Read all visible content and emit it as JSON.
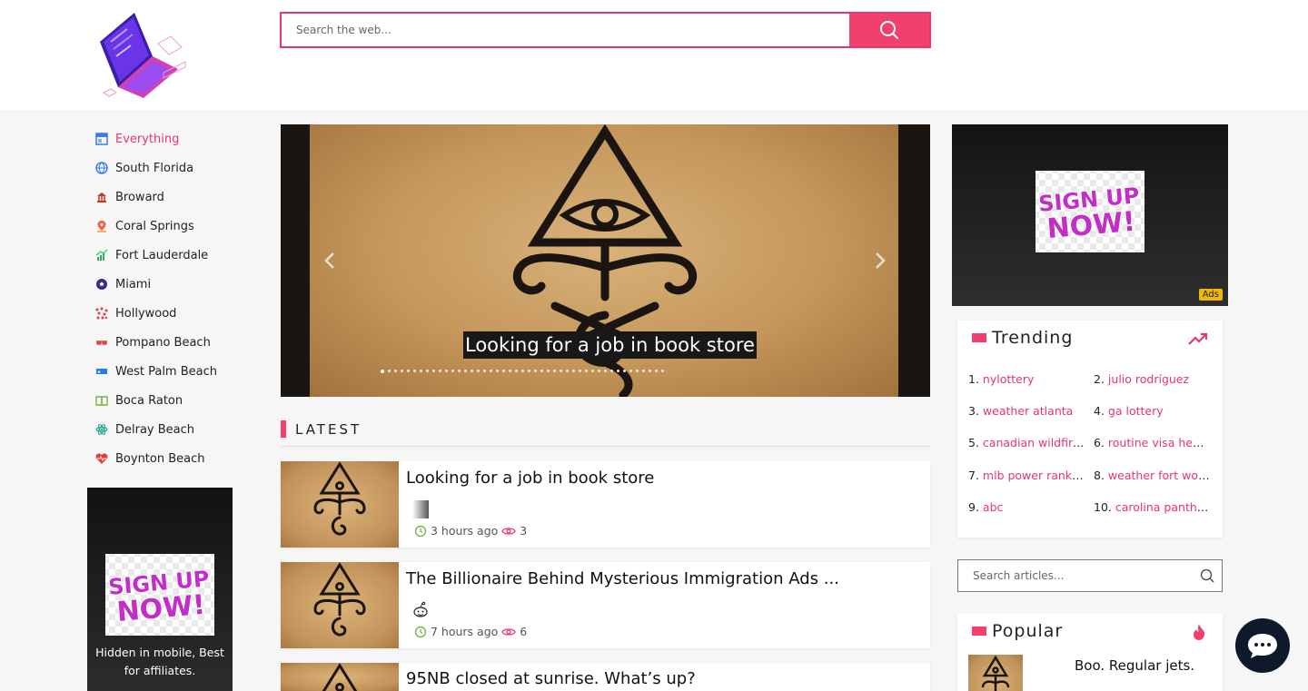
{
  "header": {
    "search_placeholder": "Search the web...",
    "search_button_icon": "search-icon",
    "accent_color": "#f2406e"
  },
  "sidebar": {
    "items": [
      {
        "label": "Everything",
        "icon": "layout-icon",
        "active": true
      },
      {
        "label": "South Florida",
        "icon": "globe-icon"
      },
      {
        "label": "Broward",
        "icon": "capitol-icon"
      },
      {
        "label": "Coral Springs",
        "icon": "map-pin-icon"
      },
      {
        "label": "Fort Lauderdale",
        "icon": "growth-chart-icon"
      },
      {
        "label": "Miami",
        "icon": "soccer-ball-icon"
      },
      {
        "label": "Hollywood",
        "icon": "dots-icon"
      },
      {
        "label": "Pompano Beach",
        "icon": "sunglasses-icon"
      },
      {
        "label": "West Palm Beach",
        "icon": "flag-icon"
      },
      {
        "label": "Boca Raton",
        "icon": "book-icon"
      },
      {
        "label": "Delray Beach",
        "icon": "atom-icon"
      },
      {
        "label": "Boynton Beach",
        "icon": "heart-pulse-icon"
      }
    ],
    "ad_caption": "Hidden in mobile, Best for affiliates."
  },
  "slider": {
    "caption": "Looking for a job in book store",
    "dot_count": 45,
    "active_dot": 1
  },
  "latest": {
    "heading": "LATEST",
    "articles": [
      {
        "title": "Looking for a job in book store",
        "time": "3 hours ago",
        "views": "3",
        "source_icon": "gradient-source-icon"
      },
      {
        "title": "The Billionaire Behind Mysterious Immigration Ads ...",
        "time": "7 hours ago",
        "views": "6",
        "source_icon": "reddit-icon"
      },
      {
        "title": "95NB closed at sunrise. What’s up?",
        "time": "",
        "views": "",
        "source_icon": ""
      }
    ]
  },
  "right_ad": {
    "tag": "Ads"
  },
  "trending": {
    "heading": "Trending",
    "items": [
      {
        "n": "1.",
        "text": "nylottery"
      },
      {
        "n": "2.",
        "text": "julio rodríguez"
      },
      {
        "n": "3.",
        "text": "weather atlanta"
      },
      {
        "n": "4.",
        "text": "ga lottery"
      },
      {
        "n": "5.",
        "text": "canadian wildfires"
      },
      {
        "n": "6.",
        "text": "routine visa hearing"
      },
      {
        "n": "7.",
        "text": "mlb power rankings"
      },
      {
        "n": "8.",
        "text": "weather fort worth"
      },
      {
        "n": "9.",
        "text": "abc"
      },
      {
        "n": "10.",
        "text": "carolina panthers"
      }
    ]
  },
  "article_search": {
    "placeholder": "Search articles..."
  },
  "popular": {
    "heading": "Popular",
    "items": [
      {
        "title": "Boo. Regular jets."
      }
    ]
  }
}
